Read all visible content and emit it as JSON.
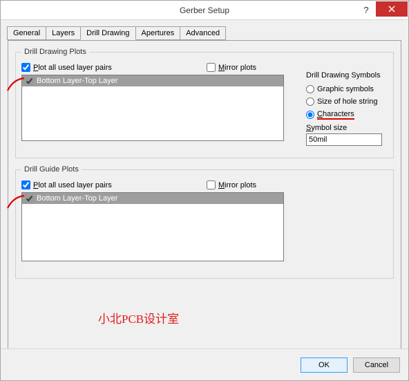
{
  "window": {
    "title": "Gerber Setup"
  },
  "tabs": {
    "t0": "General",
    "t1": "Layers",
    "t2": "Drill Drawing",
    "t3": "Apertures",
    "t4": "Advanced"
  },
  "drill_drawing_plots": {
    "legend": "Drill Drawing Plots",
    "plot_all_prefix": "P",
    "plot_all_rest": "lot all used layer pairs",
    "mirror_prefix": "M",
    "mirror_rest": "irror plots",
    "list_item": "Bottom Layer-Top Layer"
  },
  "symbols": {
    "heading": "Drill Drawing Symbols",
    "opt_graphic": "Graphic symbols",
    "opt_size": "Size of hole string",
    "opt_chars_prefix": "C",
    "opt_chars_rest": "haracters",
    "sym_size_prefix": "S",
    "sym_size_rest": "ymbol size",
    "value": "50mil"
  },
  "drill_guide_plots": {
    "legend": "Drill Guide Plots",
    "plot_all_prefix": "P",
    "plot_all_rest": "lot all used layer pairs",
    "mirror_prefix": "M",
    "mirror_rest": "irror plots",
    "list_item": "Bottom Layer-Top Layer"
  },
  "watermark": "小北PCB设计室",
  "footer": {
    "ok": "OK",
    "cancel": "Cancel"
  }
}
